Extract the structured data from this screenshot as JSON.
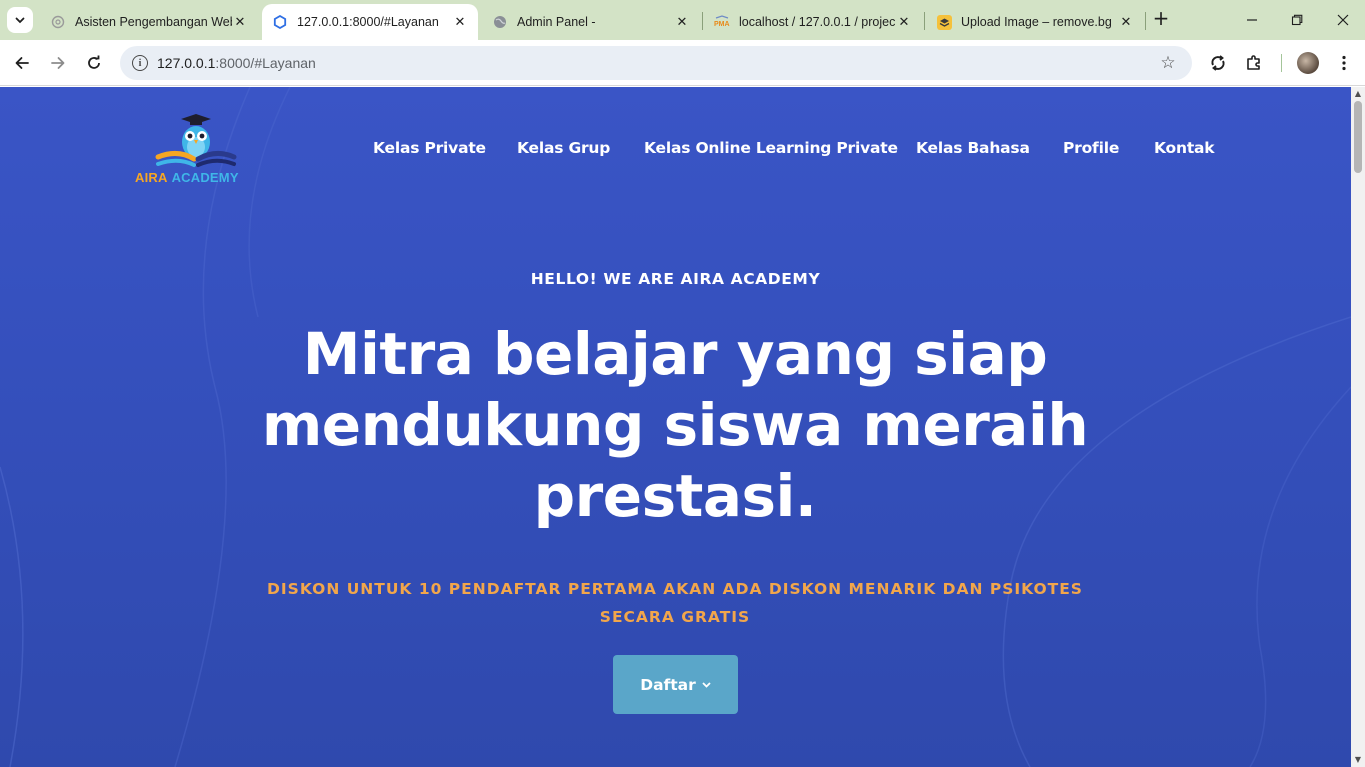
{
  "browser": {
    "tabs": [
      {
        "title": "Asisten Pengembangan Web",
        "favicon": "openai-icon",
        "active": false
      },
      {
        "title": "127.0.0.1:8000/#Layanan",
        "favicon": "hexagon-icon",
        "active": true
      },
      {
        "title": "Admin Panel -",
        "favicon": "globe-icon",
        "active": false
      },
      {
        "title": "localhost / 127.0.0.1 / projec",
        "favicon": "phpmyadmin-icon",
        "active": false
      },
      {
        "title": "Upload Image – remove.bg",
        "favicon": "removebg-icon",
        "active": false
      }
    ],
    "address": {
      "host": "127.0.0.1",
      "rest": ":8000/#Layanan"
    },
    "colors": {
      "tabstrip": "#d3e3c6",
      "omnibox": "#e9eef5"
    }
  },
  "site": {
    "logo": {
      "word1": "AIRA",
      "word2": "ACADEMY"
    },
    "nav": [
      {
        "label": "Kelas Private"
      },
      {
        "label": "Kelas Grup"
      },
      {
        "label": "Kelas Online Learning Private"
      },
      {
        "label": "Kelas Bahasa"
      },
      {
        "label": "Profile"
      },
      {
        "label": "Kontak"
      }
    ],
    "hero": {
      "eyebrow": "HELLO! WE ARE AIRA ACADEMY",
      "headline": "Mitra belajar yang siap mendukung siswa meraih prestasi.",
      "promo": "DISKON UNTUK 10 PENDAFTAR PERTAMA AKAN ADA DISKON MENARIK DAN PSIKOTES SECARA GRATIS",
      "cta_label": "Daftar"
    },
    "colors": {
      "hero_bg": "#3550bd",
      "promo": "#f2a64b",
      "cta": "#5aa6c9",
      "logo_orange": "#f6a623",
      "logo_blue": "#3fb6e8"
    }
  }
}
